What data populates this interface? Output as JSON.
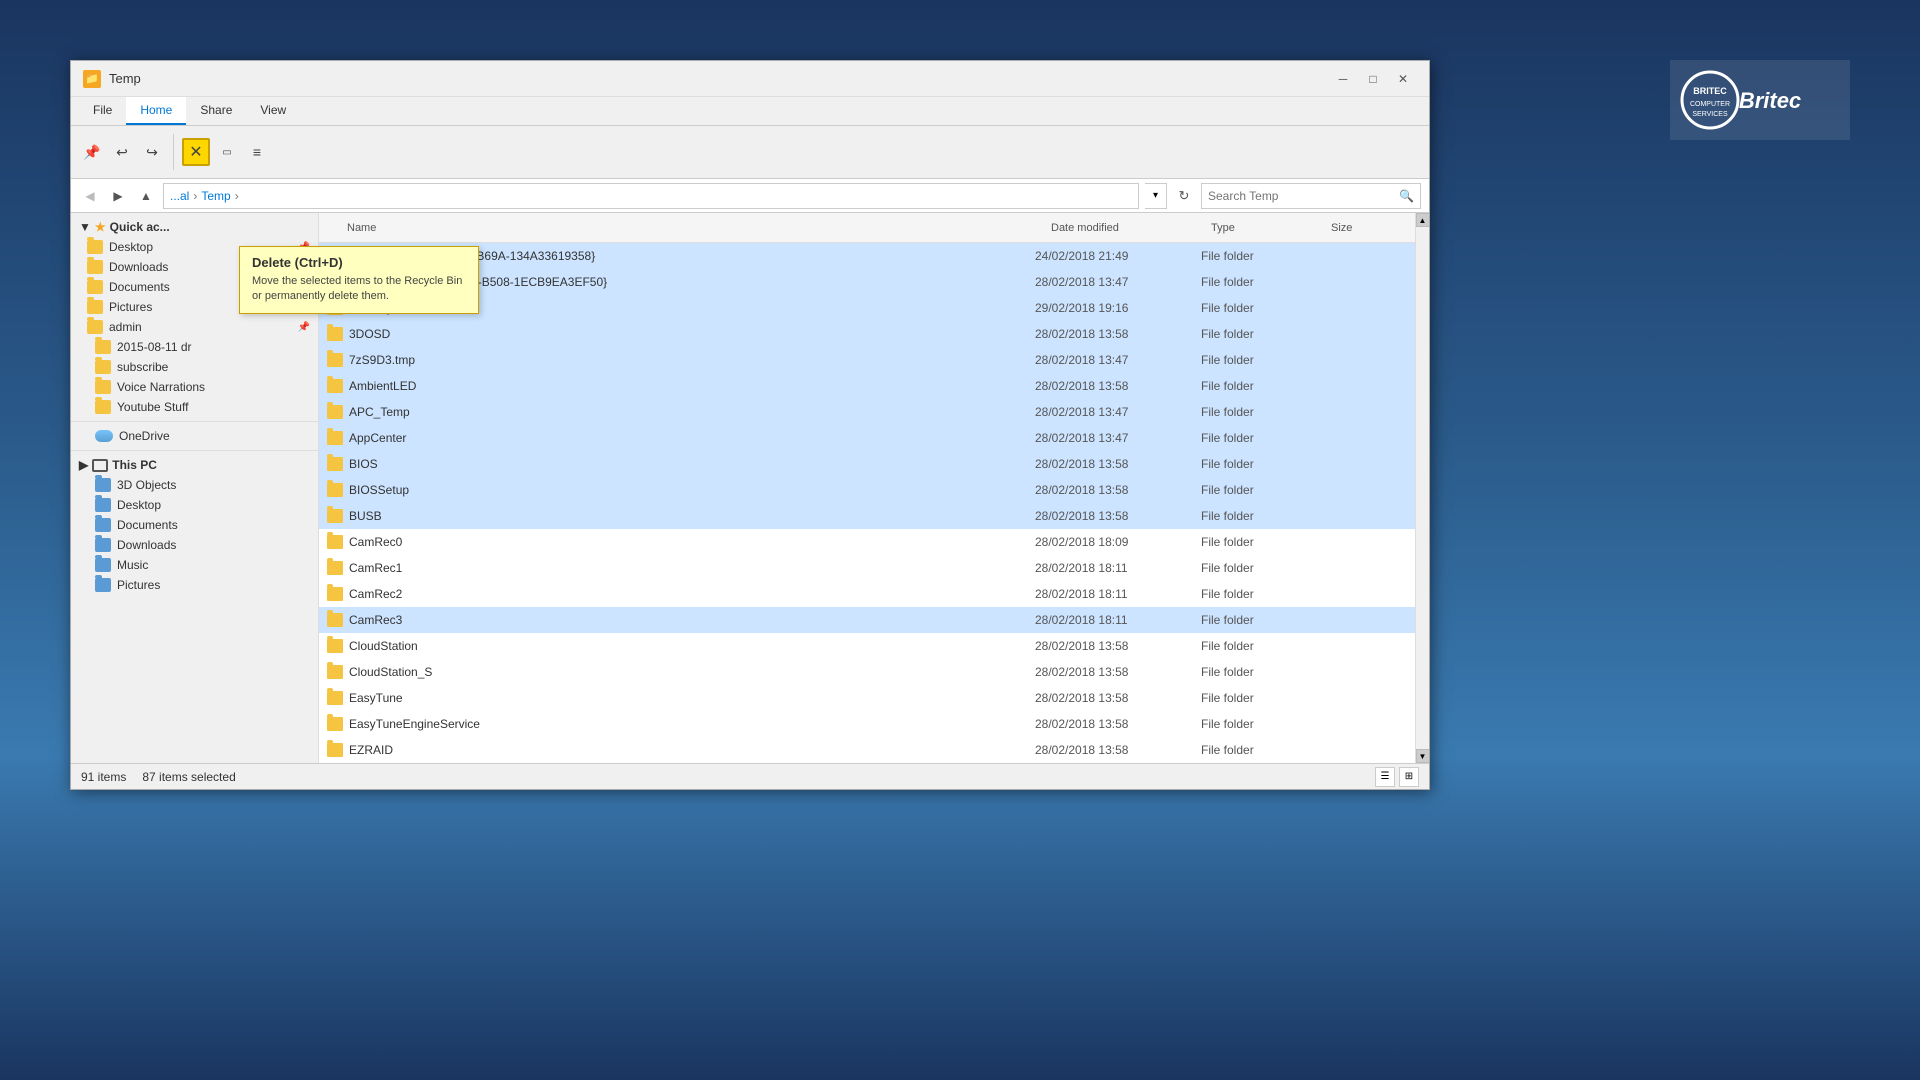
{
  "window": {
    "title": "Temp",
    "icon": "📁"
  },
  "tabs": {
    "file": "File",
    "home": "Home",
    "share": "Share",
    "view": "View"
  },
  "toolbar": {
    "delete_tooltip_title": "Delete (Ctrl+D)",
    "delete_tooltip_body": "Move the selected items to the Recycle Bin or permanently delete them."
  },
  "address_bar": {
    "path_local": "al",
    "path_temp": "Temp",
    "search_placeholder": "Search Temp"
  },
  "columns": {
    "name": "Name",
    "date_modified": "Date modified",
    "type": "Type",
    "size": "Size"
  },
  "sidebar": {
    "quick_access": "Quick ac...",
    "items_pinned": [
      {
        "label": "Desktop",
        "pinned": true
      },
      {
        "label": "Downloads",
        "pinned": true
      },
      {
        "label": "Documents",
        "pinned": true
      },
      {
        "label": "Pictures",
        "pinned": true
      }
    ],
    "items_extra": [
      {
        "label": "admin",
        "pinned": true
      },
      {
        "label": "2015-08-11 dr"
      },
      {
        "label": "subscribe"
      },
      {
        "label": "Voice Narrations"
      },
      {
        "label": "Youtube Stuff"
      }
    ],
    "onedrive": "OneDrive",
    "this_pc": "This PC",
    "this_pc_items": [
      {
        "label": "3D Objects"
      },
      {
        "label": "Desktop"
      },
      {
        "label": "Documents"
      },
      {
        "label": "Downloads"
      },
      {
        "label": "Music"
      },
      {
        "label": "Pictures"
      }
    ]
  },
  "files": [
    {
      "name": "{1565545D-5000-43EE-B69A-134A33619358}",
      "date": "24/02/2018 21:49",
      "type": "File folder",
      "selected": true
    },
    {
      "name": "{EA9A39BF-297E-4EA3-B508-1ECB9EA3EF50}",
      "date": "28/02/2018 13:47",
      "type": "File folder",
      "selected": true
    },
    {
      "name": "~Library 3.0",
      "date": "29/02/2018 19:16",
      "type": "File folder",
      "selected": true
    },
    {
      "name": "3DOSD",
      "date": "28/02/2018 13:58",
      "type": "File folder",
      "selected": true
    },
    {
      "name": "7zS9D3.tmp",
      "date": "28/02/2018 13:47",
      "type": "File folder",
      "selected": true
    },
    {
      "name": "AmbientLED",
      "date": "28/02/2018 13:58",
      "type": "File folder",
      "selected": true
    },
    {
      "name": "APC_Temp",
      "date": "28/02/2018 13:47",
      "type": "File folder",
      "selected": true
    },
    {
      "name": "AppCenter",
      "date": "28/02/2018 13:47",
      "type": "File folder",
      "selected": true
    },
    {
      "name": "BIOS",
      "date": "28/02/2018 13:58",
      "type": "File folder",
      "selected": true
    },
    {
      "name": "BIOSSetup",
      "date": "28/02/2018 13:58",
      "type": "File folder",
      "selected": true
    },
    {
      "name": "BUSB",
      "date": "28/02/2018 13:58",
      "type": "File folder",
      "selected": true
    },
    {
      "name": "CamRec0",
      "date": "28/02/2018 18:09",
      "type": "File folder",
      "selected": false
    },
    {
      "name": "CamRec1",
      "date": "28/02/2018 18:11",
      "type": "File folder",
      "selected": false
    },
    {
      "name": "CamRec2",
      "date": "28/02/2018 18:11",
      "type": "File folder",
      "selected": false
    },
    {
      "name": "CamRec3",
      "date": "28/02/2018 18:11",
      "type": "File folder",
      "selected": true
    },
    {
      "name": "CloudStation",
      "date": "28/02/2018 13:58",
      "type": "File folder",
      "selected": false
    },
    {
      "name": "CloudStation_S",
      "date": "28/02/2018 13:58",
      "type": "File folder",
      "selected": false
    },
    {
      "name": "EasyTune",
      "date": "28/02/2018 13:58",
      "type": "File folder",
      "selected": false
    },
    {
      "name": "EasyTuneEngineService",
      "date": "28/02/2018 13:58",
      "type": "File folder",
      "selected": false
    },
    {
      "name": "EZRAID",
      "date": "28/02/2018 13:58",
      "type": "File folder",
      "selected": false
    }
  ],
  "status": {
    "item_count": "91 items",
    "selected_count": "87 items selected"
  }
}
